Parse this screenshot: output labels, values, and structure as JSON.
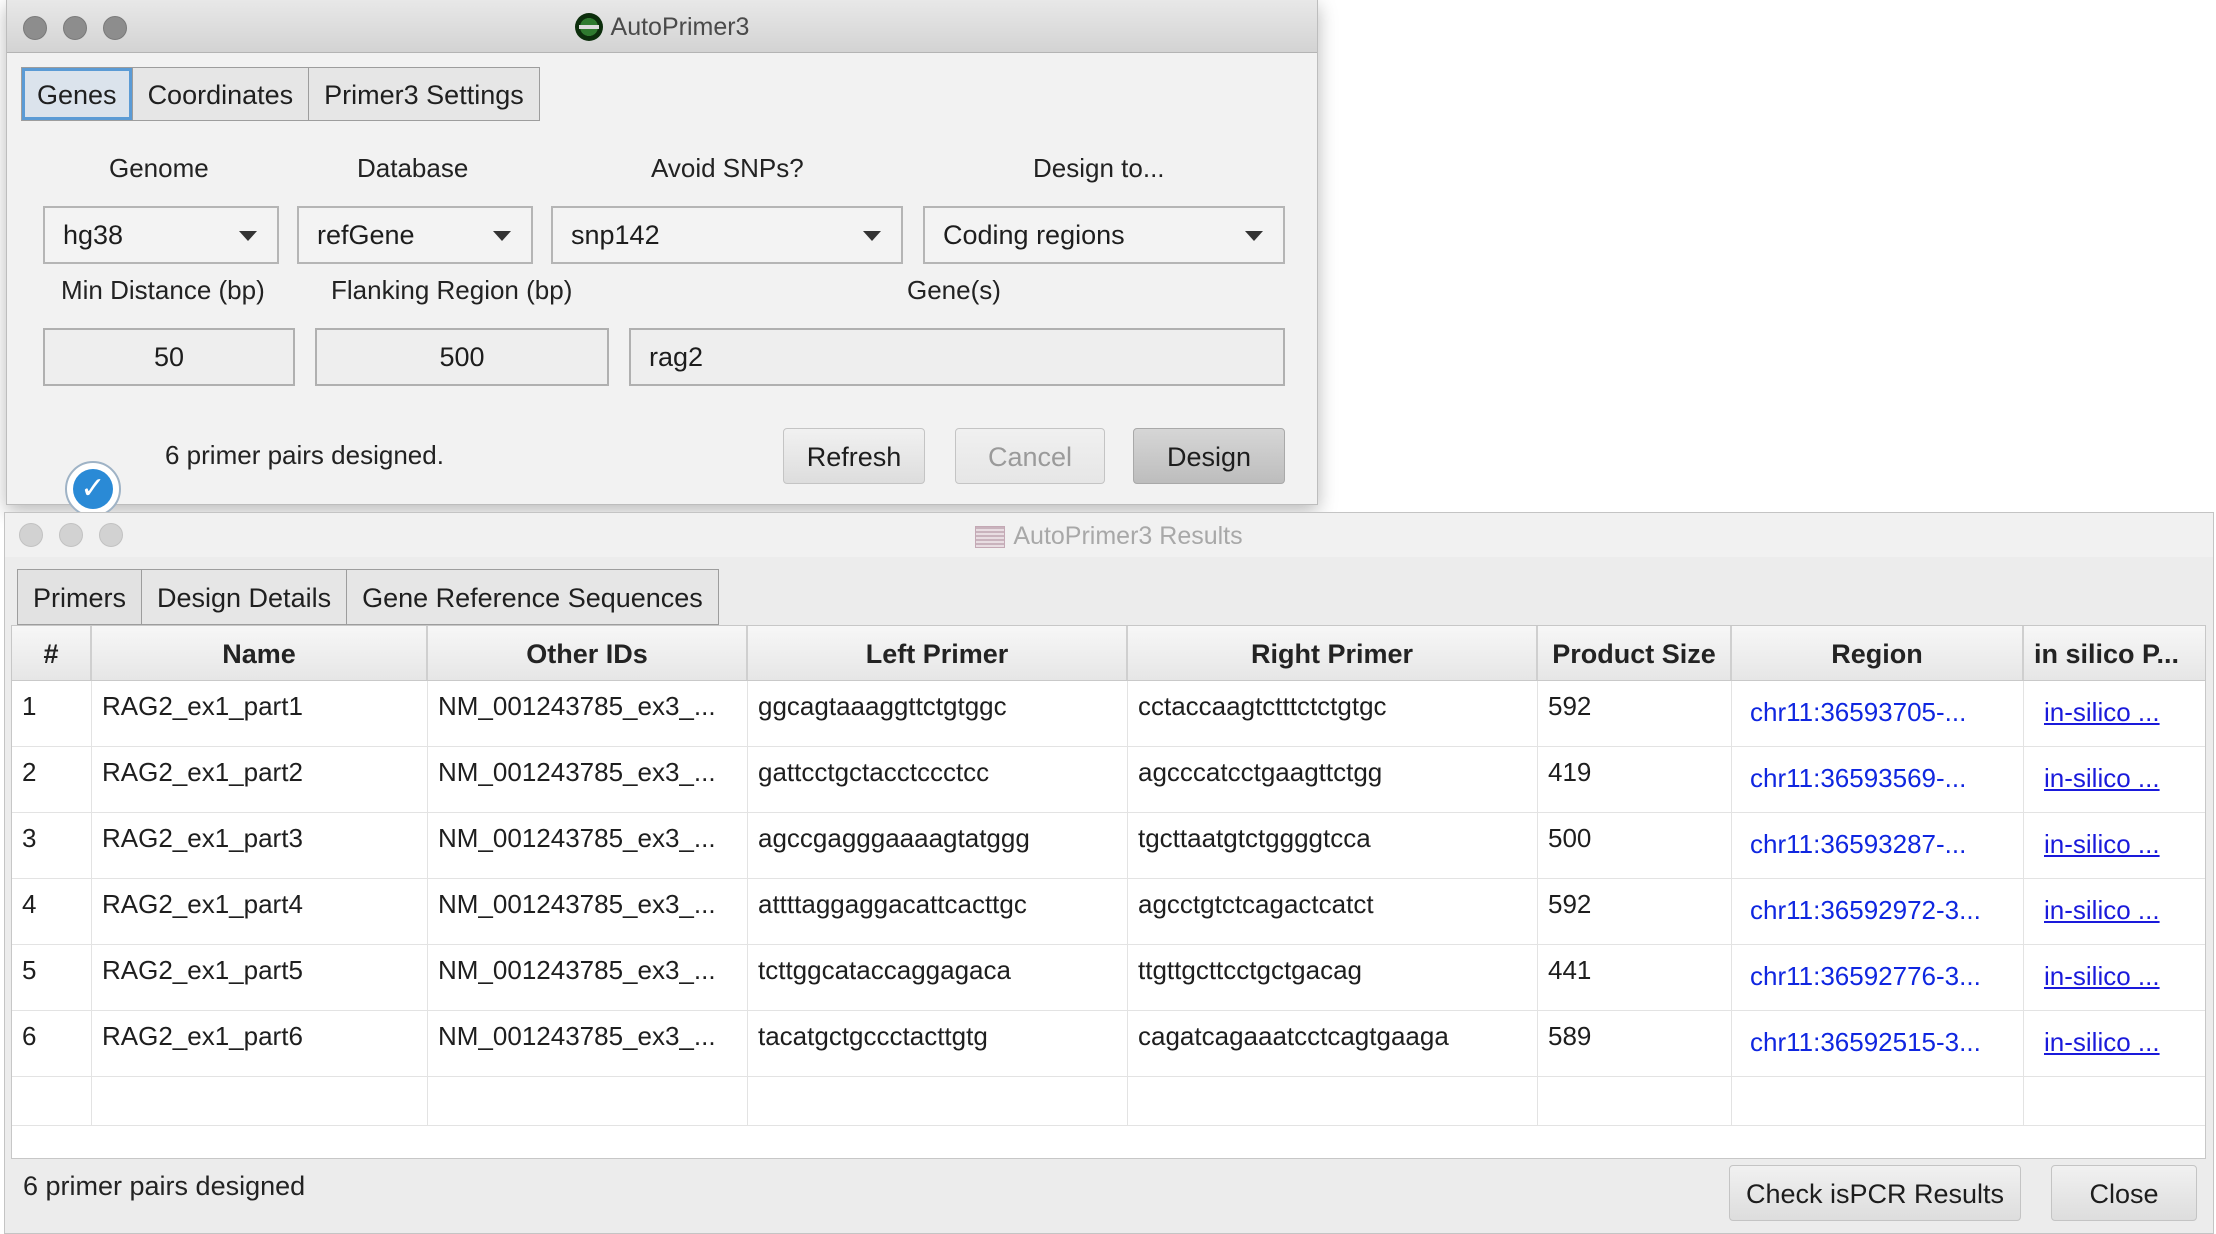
{
  "window1": {
    "title": "AutoPrimer3",
    "tabs": [
      {
        "label": "Genes"
      },
      {
        "label": "Coordinates"
      },
      {
        "label": "Primer3 Settings"
      }
    ],
    "labels": {
      "genome": "Genome",
      "database": "Database",
      "avoid_snps": "Avoid SNPs?",
      "design_to": "Design to...",
      "min_distance": "Min Distance (bp)",
      "flanking": "Flanking Region (bp)",
      "genes": "Gene(s)"
    },
    "selects": {
      "genome": "hg38",
      "database": "refGene",
      "snps": "snp142",
      "design_to": "Coding regions"
    },
    "inputs": {
      "min_distance": "50",
      "flanking": "500",
      "genes": "rag2"
    },
    "status": "6 primer pairs designed.",
    "buttons": {
      "refresh": "Refresh",
      "cancel": "Cancel",
      "design": "Design"
    },
    "accent": "#2a8ad6"
  },
  "window2": {
    "title": "AutoPrimer3 Results",
    "tabs": [
      {
        "label": "Primers"
      },
      {
        "label": "Design Details"
      },
      {
        "label": "Gene Reference Sequences"
      }
    ],
    "columns": [
      "#",
      "Name",
      "Other IDs",
      "Left Primer",
      "Right Primer",
      "Product Size",
      "Region",
      "in silico P..."
    ],
    "rows": [
      {
        "num": "1",
        "name": "RAG2_ex1_part1",
        "other_ids": "NM_001243785_ex3_...",
        "left": "ggcagtaaaggttctgtggc",
        "right": "cctaccaagtctttctctgtgc",
        "size": "592",
        "region": "chr11:36593705-...",
        "insilico": "in-silico ..."
      },
      {
        "num": "2",
        "name": "RAG2_ex1_part2",
        "other_ids": "NM_001243785_ex3_...",
        "left": "gattcctgctacctccctcc",
        "right": "agcccatcctgaagttctgg",
        "size": "419",
        "region": "chr11:36593569-...",
        "insilico": "in-silico ..."
      },
      {
        "num": "3",
        "name": "RAG2_ex1_part3",
        "other_ids": "NM_001243785_ex3_...",
        "left": "agccgagggaaaagtatggg",
        "right": "tgcttaatgtctggggtcca",
        "size": "500",
        "region": "chr11:36593287-...",
        "insilico": "in-silico ..."
      },
      {
        "num": "4",
        "name": "RAG2_ex1_part4",
        "other_ids": "NM_001243785_ex3_...",
        "left": "attttaggaggacattcacttgc",
        "right": "agcctgtctcagactcatct",
        "size": "592",
        "region": "chr11:36592972-3...",
        "insilico": "in-silico ..."
      },
      {
        "num": "5",
        "name": "RAG2_ex1_part5",
        "other_ids": "NM_001243785_ex3_...",
        "left": "tcttggcataccaggagaca",
        "right": "ttgttgcttcctgctgacag",
        "size": "441",
        "region": "chr11:36592776-3...",
        "insilico": "in-silico ..."
      },
      {
        "num": "6",
        "name": "RAG2_ex1_part6",
        "other_ids": "NM_001243785_ex3_...",
        "left": "tacatgctgccctacttgtg",
        "right": "cagatcagaaatcctcagtgaaga",
        "size": "589",
        "region": "chr11:36592515-3...",
        "insilico": "in-silico ..."
      }
    ],
    "status": "6 primer pairs designed",
    "buttons": {
      "check": "Check isPCR Results",
      "close": "Close"
    },
    "link_color": "#0f26e0"
  }
}
